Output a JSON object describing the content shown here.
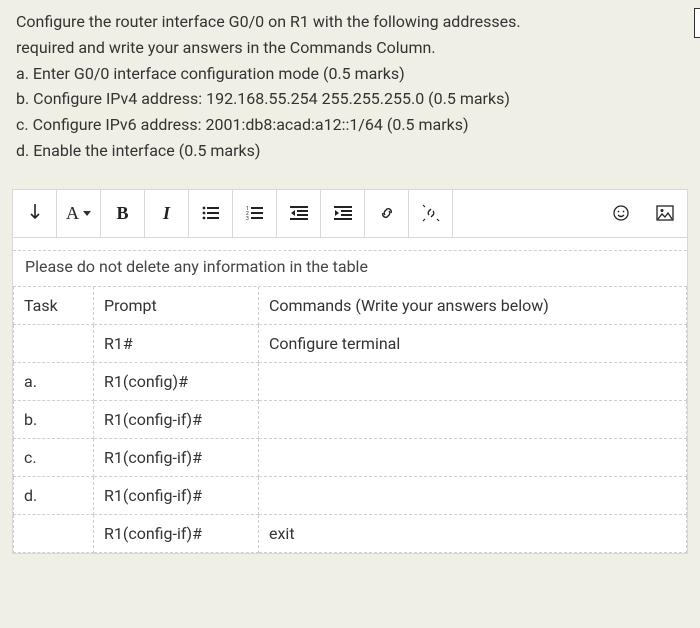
{
  "question": {
    "line1": "Configure the router interface G0/0 on R1 with the following addresses.",
    "line2": "required and write your answers in the Commands Column.",
    "a": "a. Enter G0/0 interface configuration mode (0.5 marks)",
    "b": "b. Configure IPv4 address: 192.168.55.254 255.255.255.0 (0.5 marks)",
    "c": "c. Configure IPv6 address: 2001:db8:acad:a12::1/64 (0.5 marks)",
    "d": "d. Enable the interface (0.5 marks)"
  },
  "toolbar": {
    "font_label": "A",
    "bold_label": "B",
    "italic_label": "I"
  },
  "notice": "Please do not delete any information in the table",
  "headers": {
    "task": "Task",
    "prompt": "Prompt",
    "commands": "Commands (Write your answers below)"
  },
  "rows": [
    {
      "task": "",
      "prompt": "R1#",
      "cmd": "Configure terminal"
    },
    {
      "task": "a.",
      "prompt": "R1(config)#",
      "cmd": ""
    },
    {
      "task": "b.",
      "prompt": "R1(config-if)#",
      "cmd": ""
    },
    {
      "task": "c.",
      "prompt": "R1(config-if)#",
      "cmd": ""
    },
    {
      "task": "d.",
      "prompt": "R1(config-if)#",
      "cmd": ""
    },
    {
      "task": "",
      "prompt": "R1(config-if)#",
      "cmd": "exit"
    }
  ]
}
